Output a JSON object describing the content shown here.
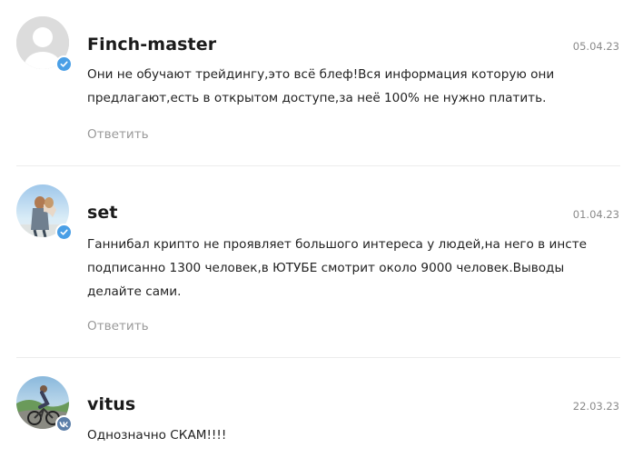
{
  "colors": {
    "verified_badge": "#4a9fe6",
    "vk_badge": "#5b7ea8",
    "reply_link": "#9a9a9a",
    "date": "#8a8a8a",
    "divider": "#ececec"
  },
  "comments": [
    {
      "username": "Finch-master",
      "date": "05.04.23",
      "text_lines": [
        "Они не обучают трейдингу,это всё блеф!Вся информация которую они",
        "предлагают,есть в открытом доступе,за неё 100% не нужно платить."
      ],
      "reply_label": "Ответить",
      "avatar": "default-user-avatar",
      "badge_icon": "check-icon"
    },
    {
      "username": "set",
      "date": "01.04.23",
      "text_lines": [
        "Ганнибал крипто не проявляет большого интереса у людей,на него в инсте",
        "подписанно 1300 человек,в ЮТУБЕ смотрит около 9000 человек.Выводы",
        "делайте сами."
      ],
      "reply_label": "Ответить",
      "avatar": "photo-avatar-couple",
      "badge_icon": "check-icon"
    },
    {
      "username": "vitus",
      "date": "22.03.23",
      "text_lines": [
        "Однозначно СКАМ!!!!"
      ],
      "avatar": "photo-avatar-cyclist",
      "badge_icon": "vk-icon"
    }
  ]
}
